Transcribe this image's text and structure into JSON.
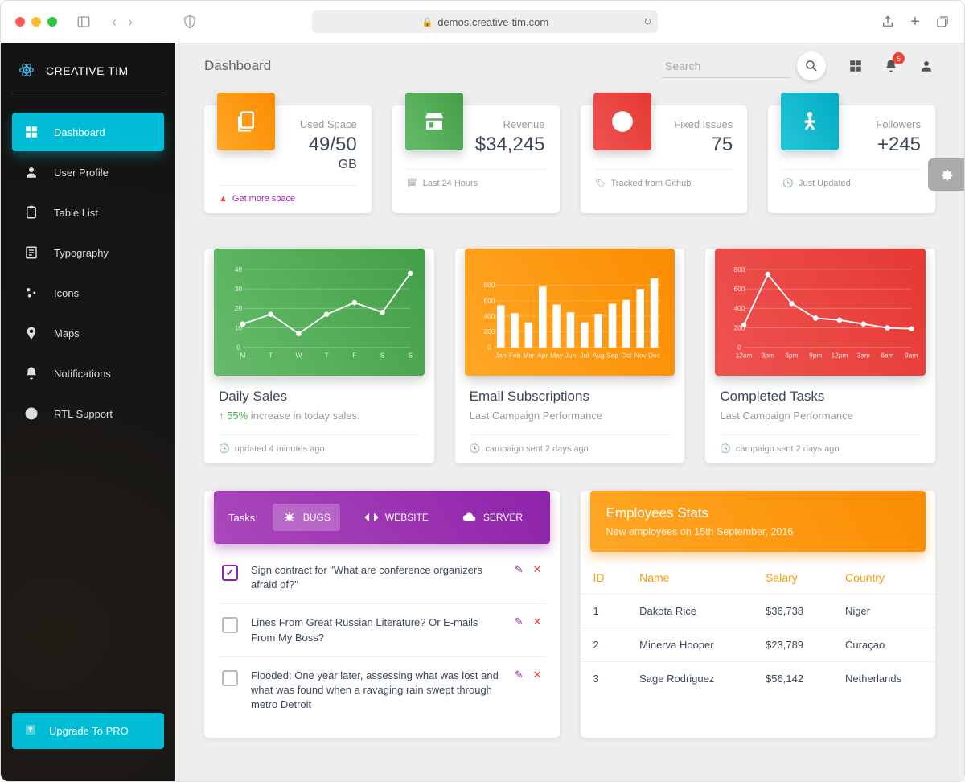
{
  "browser": {
    "url": "demos.creative-tim.com"
  },
  "brand": {
    "name": "CREATIVE TIM"
  },
  "sidebar": {
    "items": [
      {
        "label": "Dashboard"
      },
      {
        "label": "User Profile"
      },
      {
        "label": "Table List"
      },
      {
        "label": "Typography"
      },
      {
        "label": "Icons"
      },
      {
        "label": "Maps"
      },
      {
        "label": "Notifications"
      },
      {
        "label": "RTL Support"
      }
    ],
    "upgrade": "Upgrade To PRO"
  },
  "topbar": {
    "page_title": "Dashboard",
    "search_placeholder": "Search",
    "notif_count": "5"
  },
  "stats": [
    {
      "label": "Used Space",
      "value": "49/50",
      "sub": "GB",
      "footer": "Get more space",
      "foot_type": "warning"
    },
    {
      "label": "Revenue",
      "value": "$34,245",
      "footer": "Last 24 Hours"
    },
    {
      "label": "Fixed Issues",
      "value": "75",
      "footer": "Tracked from Github"
    },
    {
      "label": "Followers",
      "value": "+245",
      "footer": "Just Updated"
    }
  ],
  "charts": [
    {
      "title": "Daily Sales",
      "sub_prefix": "↑ ",
      "sub_em": "55%",
      "sub_rest": " increase in today sales.",
      "footer": "updated 4 minutes ago"
    },
    {
      "title": "Email Subscriptions",
      "sub": "Last Campaign Performance",
      "footer": "campaign sent 2 days ago"
    },
    {
      "title": "Completed Tasks",
      "sub": "Last Campaign Performance",
      "footer": "campaign sent 2 days ago"
    }
  ],
  "chart_data": [
    {
      "type": "line",
      "categories": [
        "M",
        "T",
        "W",
        "T",
        "F",
        "S",
        "S"
      ],
      "values": [
        12,
        17,
        7,
        17,
        23,
        18,
        38
      ],
      "ylim": [
        0,
        40
      ],
      "yticks": [
        0,
        10,
        20,
        30,
        40
      ]
    },
    {
      "type": "bar",
      "categories": [
        "Jan",
        "Feb",
        "Mar",
        "Apr",
        "May",
        "Jun",
        "Jul",
        "Aug",
        "Sep",
        "Oct",
        "Nov",
        "Dec"
      ],
      "values": [
        540,
        440,
        320,
        780,
        550,
        450,
        320,
        430,
        560,
        610,
        750,
        890
      ],
      "ylim": [
        0,
        1000
      ],
      "yticks": [
        0,
        200,
        400,
        600,
        800
      ]
    },
    {
      "type": "line",
      "categories": [
        "12am",
        "3pm",
        "6pm",
        "9pm",
        "12pm",
        "3am",
        "6am",
        "9am"
      ],
      "values": [
        230,
        750,
        450,
        300,
        280,
        240,
        200,
        190
      ],
      "ylim": [
        0,
        800
      ],
      "yticks": [
        0,
        200,
        400,
        600,
        800
      ]
    }
  ],
  "tasks": {
    "label": "Tasks:",
    "tabs": [
      "BUGS",
      "WEBSITE",
      "SERVER"
    ],
    "items": [
      {
        "text": "Sign contract for \"What are conference organizers afraid of?\"",
        "checked": true
      },
      {
        "text": "Lines From Great Russian Literature? Or E-mails From My Boss?",
        "checked": false
      },
      {
        "text": "Flooded: One year later, assessing what was lost and what was found when a ravaging rain swept through metro Detroit",
        "checked": false
      }
    ]
  },
  "employees": {
    "title": "Employees Stats",
    "subtitle": "New employees on 15th September, 2016",
    "columns": [
      "ID",
      "Name",
      "Salary",
      "Country"
    ],
    "rows": [
      [
        "1",
        "Dakota Rice",
        "$36,738",
        "Niger"
      ],
      [
        "2",
        "Minerva Hooper",
        "$23,789",
        "Curaçao"
      ],
      [
        "3",
        "Sage Rodriguez",
        "$56,142",
        "Netherlands"
      ]
    ]
  }
}
